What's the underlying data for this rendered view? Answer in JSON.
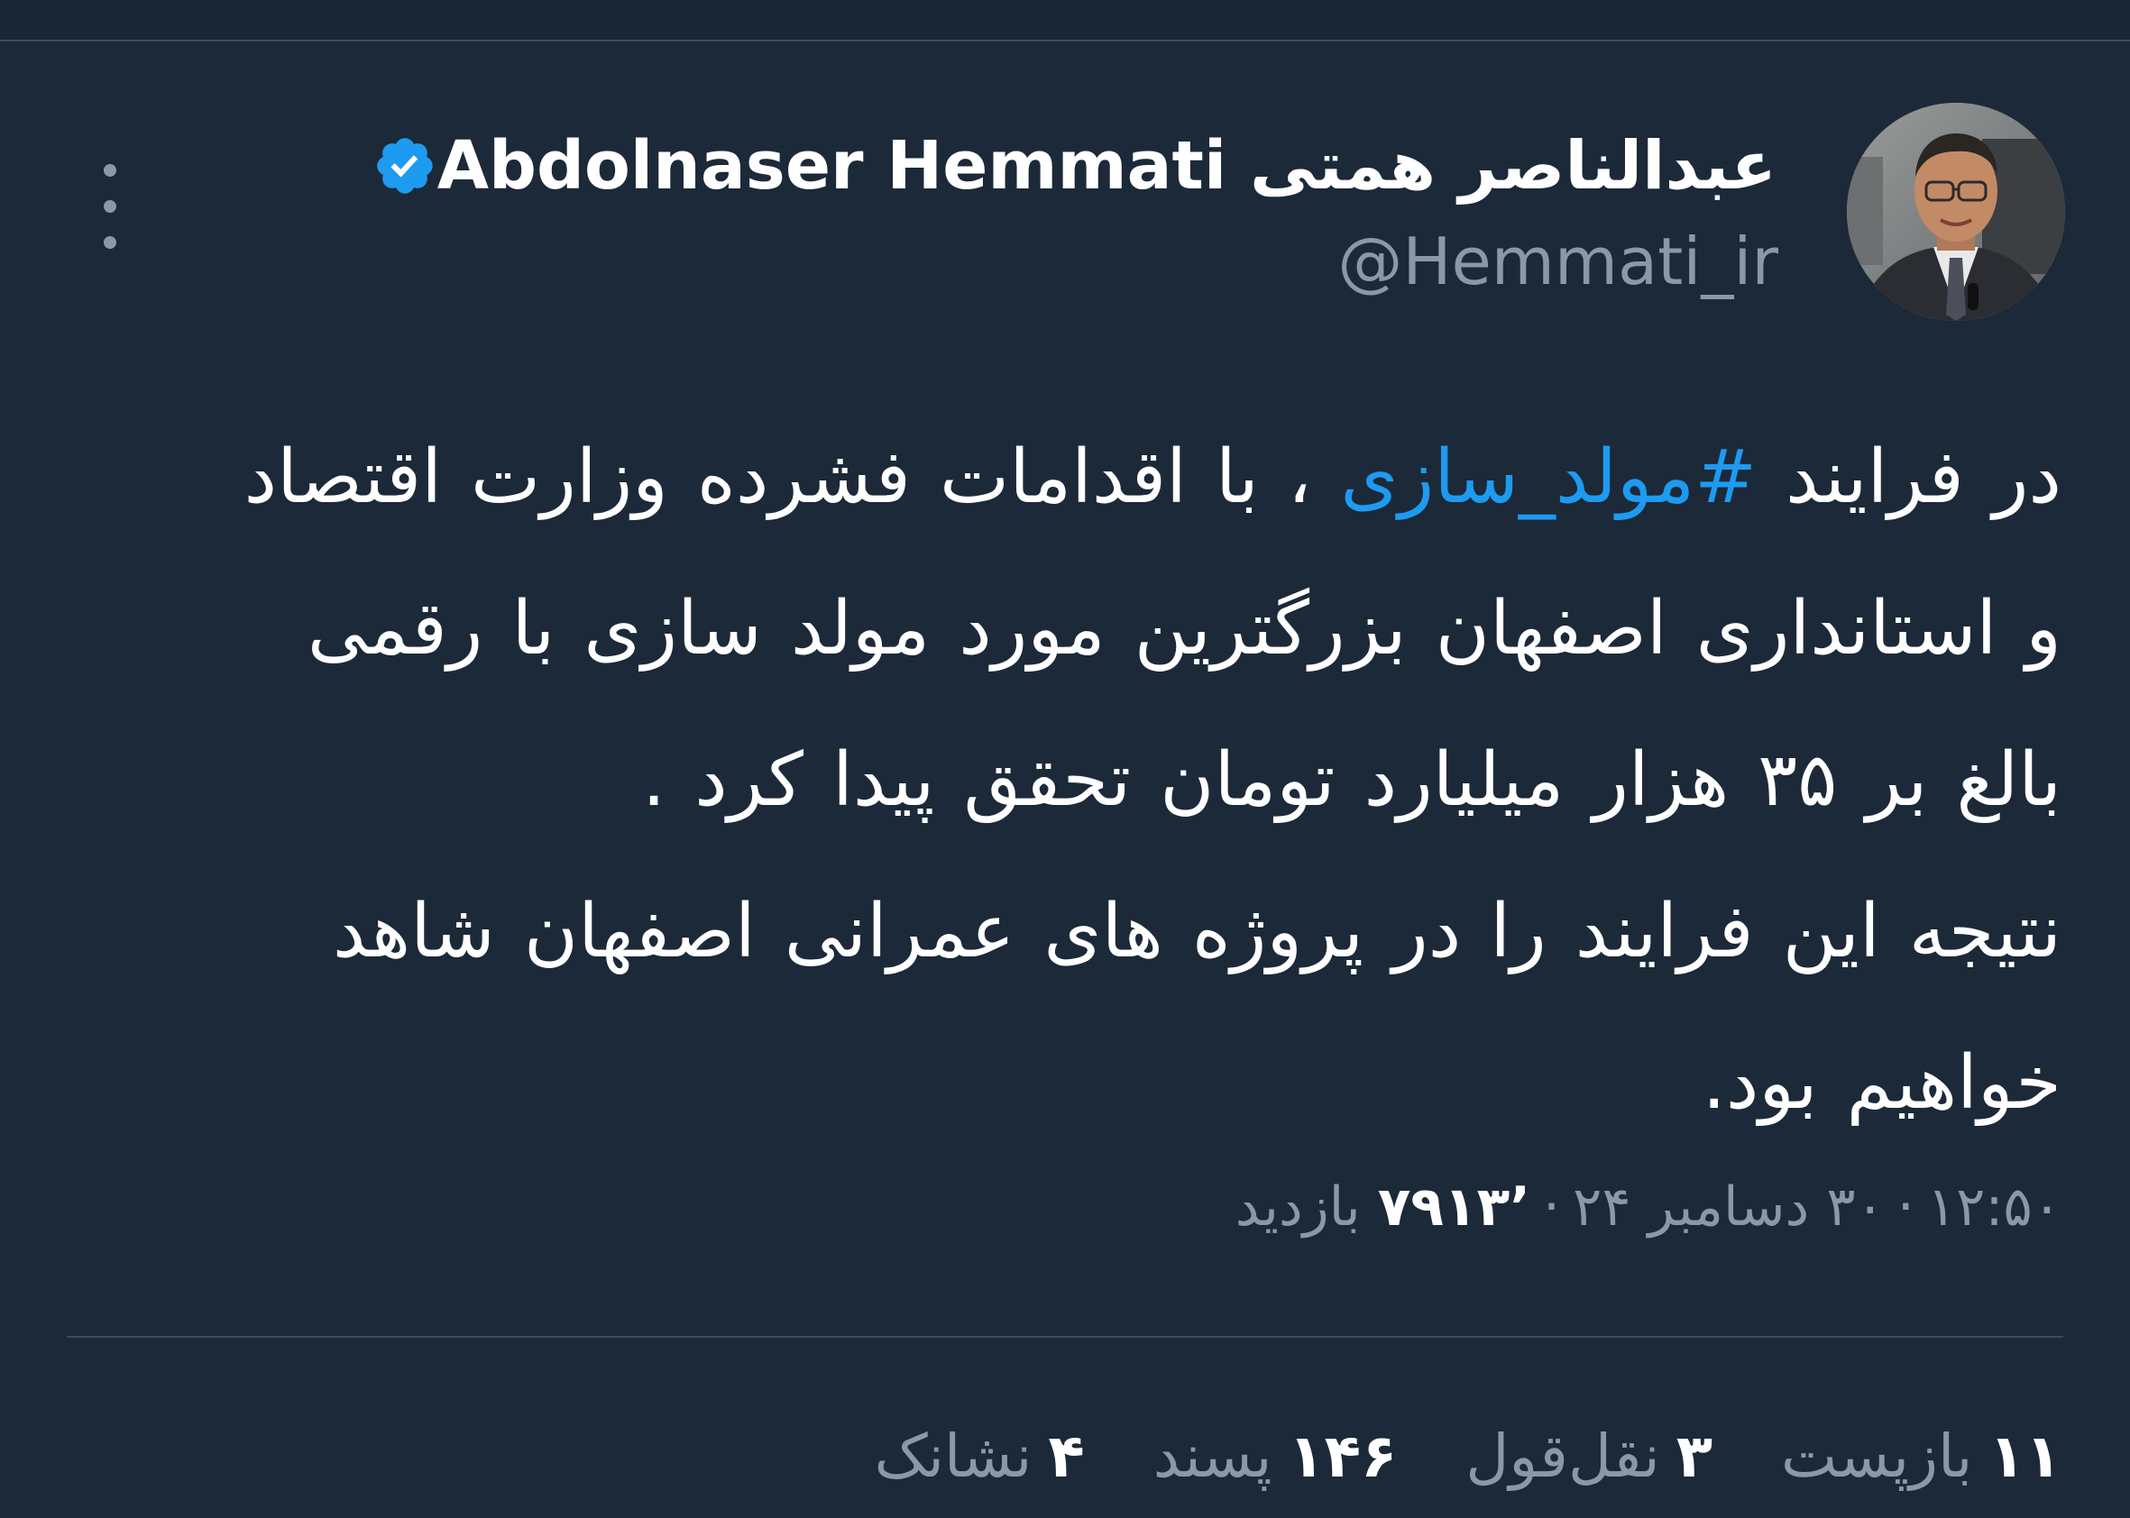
{
  "theme": {
    "background": "#1c2938",
    "accent": "#1d9bf0",
    "text_primary": "#ffffff",
    "text_secondary": "#8b98a5"
  },
  "author": {
    "display_name": "Abdolnaser Hemmati عبدالناصر همتی",
    "handle": "@Hemmati_ir",
    "verified_icon": "verified-badge-icon",
    "avatar_icon": "avatar-photo"
  },
  "more_options_icon": "more-vertical-icon",
  "tweet": {
    "lines": [
      {
        "before": "در فرایند ",
        "hashtag": "#مولد_سازی",
        "after": " ، با اقدامات فشرده وزارت اقتصاد"
      },
      {
        "text": "و استانداری اصفهان بزرگترین مورد مولد سازی با رقمی"
      },
      {
        "text": "بالغ بر ۳۵ هزار میلیارد تومان تحقق پیدا کرد ."
      },
      {
        "text": "نتیجه این فرایند را در پروژه های  عمرانی اصفهان شاهد"
      },
      {
        "text": "خواهیم بود."
      }
    ]
  },
  "meta": {
    "time": "۱۲:۵۰",
    "date": "۳۰ دسامبر ۲۴",
    "views_count": "۷۹۱۳٬",
    "views_label": "بازدید",
    "separator": "·"
  },
  "stats": [
    {
      "count": "۱۱",
      "label": "بازپست"
    },
    {
      "count": "۳",
      "label": "نقل‌قول"
    },
    {
      "count": "۱۴۶",
      "label": "پسند"
    },
    {
      "count": "۴",
      "label": "نشانک"
    }
  ]
}
